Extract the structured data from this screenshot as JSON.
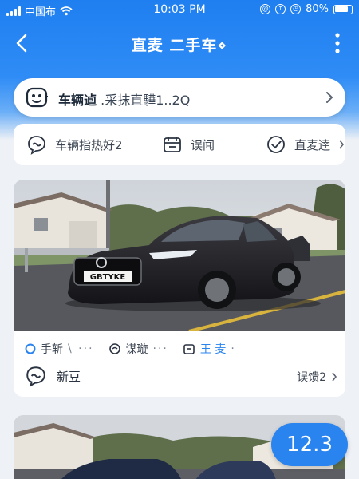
{
  "status_bar": {
    "carrier": "中国布",
    "time": "10:03 PM",
    "battery": "80%"
  },
  "nav": {
    "title": "直麦 二手车⋄"
  },
  "search": {
    "label": "车辆逌",
    "text": ".采抹直驊1..2Q"
  },
  "quick_row": [
    {
      "icon": "chat-bubble-icon",
      "label": "车辆指热好2"
    },
    {
      "icon": "calendar-icon",
      "label": "误闻"
    },
    {
      "icon": "check-shield-icon",
      "label": "直麦逵"
    }
  ],
  "car_card": {
    "plate": "GBTYKE",
    "meta": [
      {
        "icon": "circle-icon",
        "label": "手斩",
        "dots": "\\ ⋅⋅⋅"
      },
      {
        "icon": "chat-icon",
        "label": "谋璇",
        "dots": "⋅⋅⋅"
      },
      {
        "icon": "box-icon",
        "label": "王 麦",
        "dots": "⋅"
      }
    ],
    "foot_left": "新豆",
    "foot_right": "误馈2"
  },
  "price_badge": "12.3",
  "colors": {
    "accent": "#2a84ef",
    "header_top": "#1f7ff0"
  }
}
